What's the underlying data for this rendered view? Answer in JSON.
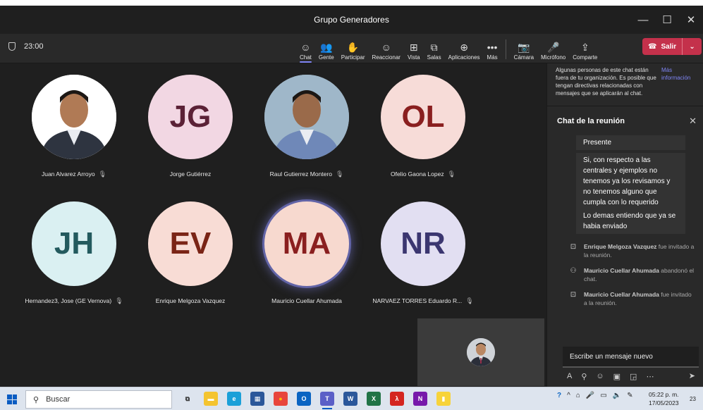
{
  "window": {
    "title": "Grupo Generadores",
    "controls": [
      "—",
      "☐",
      "✕"
    ]
  },
  "toolbar": {
    "timer": "23:00",
    "buttons": [
      {
        "label": "Chat",
        "icon": "chat-icon",
        "glyph": "☺"
      },
      {
        "label": "Gente",
        "icon": "people-icon",
        "glyph": "👥"
      },
      {
        "label": "Participar",
        "icon": "raise-hand-icon",
        "glyph": "✋"
      },
      {
        "label": "Reaccionar",
        "icon": "react-icon",
        "glyph": "☺"
      },
      {
        "label": "Vista",
        "icon": "view-icon",
        "glyph": "⊞"
      },
      {
        "label": "Salas",
        "icon": "rooms-icon",
        "glyph": "⧉"
      },
      {
        "label": "Aplicaciones",
        "icon": "apps-icon",
        "glyph": "⊕"
      },
      {
        "label": "Más",
        "icon": "more-icon",
        "glyph": "•••"
      }
    ],
    "device_buttons": [
      {
        "label": "Cámara",
        "icon": "camera-off-icon",
        "glyph": "📷"
      },
      {
        "label": "Micrófono",
        "icon": "microphone-icon",
        "glyph": "🎤"
      },
      {
        "label": "Comparte",
        "icon": "share-icon",
        "glyph": "⇪"
      }
    ],
    "leave_label": "Salir"
  },
  "participants": [
    {
      "name": "Juan Alvarez Arroyo",
      "initials": "",
      "photo": true,
      "bg": "#ffffff",
      "fg": "#3b2a20",
      "muted": true
    },
    {
      "name": "Jorge Gutiérrez",
      "initials": "JG",
      "photo": false,
      "bg": "#f2d7e3",
      "fg": "#5b2136",
      "muted": false
    },
    {
      "name": "Raul Gutierrez Montero",
      "initials": "",
      "photo": true,
      "bg": "#9fb7c9",
      "fg": "#3b2a20",
      "muted": true
    },
    {
      "name": "Ofelio Gaona Lopez",
      "initials": "OL",
      "photo": false,
      "bg": "#f7dcd8",
      "fg": "#8a1f1f",
      "muted": true
    },
    {
      "name": "Hernandez3, Jose (GE Vernova)",
      "initials": "JH",
      "photo": false,
      "bg": "#daf0f2",
      "fg": "#235a5e",
      "muted": true
    },
    {
      "name": "Enrique Melgoza Vazquez",
      "initials": "EV",
      "photo": false,
      "bg": "#f8dcd5",
      "fg": "#7a2416",
      "muted": false
    },
    {
      "name": "Mauricio Cuellar Ahumada",
      "initials": "MA",
      "photo": false,
      "bg": "#f7d9cf",
      "fg": "#8a1f1f",
      "muted": false,
      "speaking": true
    },
    {
      "name": "NARVAEZ TORRES Eduardo R...",
      "initials": "NR",
      "photo": false,
      "bg": "#e2dff2",
      "fg": "#3b3670",
      "muted": true
    }
  ],
  "chat": {
    "notice": "Algunas personas de este chat están fuera de tu organización. Es posible que tengan directivas relacionadas con mensajes que se aplicarán al chat.",
    "notice_link": "Más información",
    "title": "Chat de la reunión",
    "messages": [
      "Presente",
      "Si, con respecto a las centrales  y ejemplos no tenemos ya los revisamos y no tenemos alguno que cumpla con lo requerido",
      "Lo demas entiendo que ya se habia enviado"
    ],
    "events": [
      {
        "who": "Enrique Melgoza Vazquez",
        "text": " fue invitado a la reunión.",
        "icon": "invite-icon",
        "glyph": "⊡"
      },
      {
        "who": "Mauricio Cuellar Ahumada",
        "text": " abandonó el chat.",
        "icon": "left-chat-icon",
        "glyph": "⚇"
      },
      {
        "who": "Mauricio Cuellar Ahumada",
        "text": " fue invitado a la reunión.",
        "icon": "invite-icon",
        "glyph": "⊡"
      }
    ],
    "compose_placeholder": "Escribe un mensaje nuevo",
    "compose_tools": [
      {
        "icon": "format-icon",
        "glyph": "A"
      },
      {
        "icon": "attach-icon",
        "glyph": "⚲"
      },
      {
        "icon": "emoji-icon",
        "glyph": "☺"
      },
      {
        "icon": "gif-icon",
        "glyph": "▣"
      },
      {
        "icon": "sticker-icon",
        "glyph": "◲"
      },
      {
        "icon": "more-options-icon",
        "glyph": "⋯"
      }
    ],
    "send_glyph": "➤"
  },
  "taskbar": {
    "search_placeholder": "Buscar",
    "apps": [
      {
        "icon": "task-view-icon",
        "glyph": "⧉",
        "bg": "#dde4ee",
        "fg": "#333"
      },
      {
        "icon": "file-explorer-icon",
        "glyph": "▬",
        "bg": "#f4c430",
        "fg": "#fff"
      },
      {
        "icon": "edge-icon",
        "glyph": "e",
        "bg": "#1ba0d8",
        "fg": "#fff"
      },
      {
        "icon": "calendar-app-icon",
        "glyph": "▦",
        "bg": "#2b579a",
        "fg": "#fff"
      },
      {
        "icon": "chrome-icon",
        "glyph": "●",
        "bg": "#e8453c",
        "fg": "#fbbc05"
      },
      {
        "icon": "outlook-icon",
        "glyph": "O",
        "bg": "#0a64c2",
        "fg": "#fff"
      },
      {
        "icon": "teams-icon",
        "glyph": "T",
        "bg": "#5b5fc7",
        "fg": "#fff",
        "active": true
      },
      {
        "icon": "word-icon",
        "glyph": "W",
        "bg": "#2b579a",
        "fg": "#fff"
      },
      {
        "icon": "excel-icon",
        "glyph": "X",
        "bg": "#217346",
        "fg": "#fff"
      },
      {
        "icon": "acrobat-icon",
        "glyph": "λ",
        "bg": "#d4251f",
        "fg": "#fff"
      },
      {
        "icon": "onenote-icon",
        "glyph": "N",
        "bg": "#7719aa",
        "fg": "#fff"
      },
      {
        "icon": "sticky-notes-icon",
        "glyph": "▮",
        "bg": "#f7d33a",
        "fg": "#fff"
      }
    ],
    "time": "05:22 p. m.",
    "date": "17/05/2023",
    "notifications": "23"
  }
}
